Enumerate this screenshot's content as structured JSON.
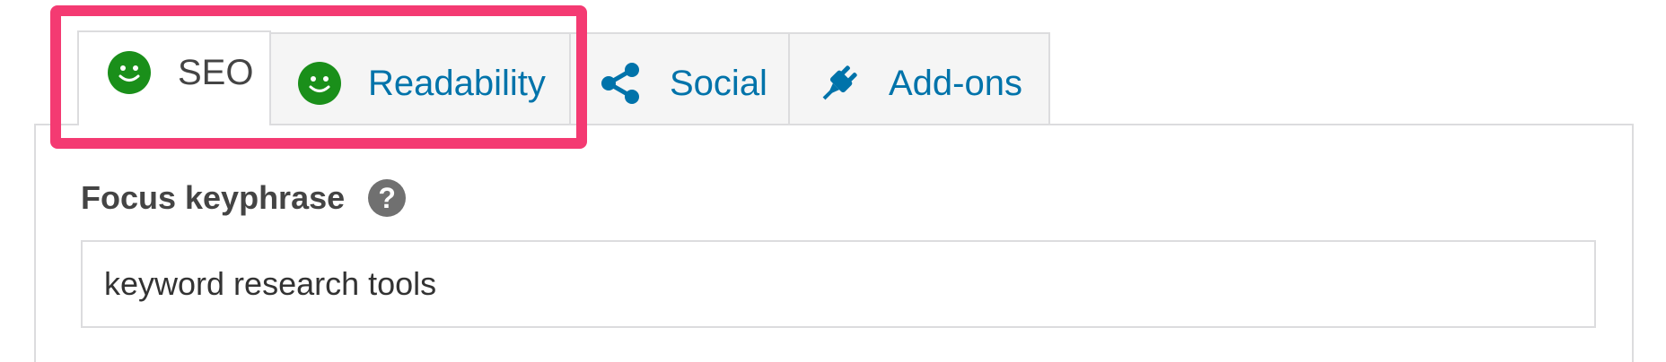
{
  "tabs": {
    "seo": {
      "label": "SEO",
      "icon": "smiley-face-icon",
      "status_color": "#1a8f1a"
    },
    "readability": {
      "label": "Readability",
      "icon": "smiley-face-icon",
      "status_color": "#1a8f1a"
    },
    "social": {
      "label": "Social",
      "icon": "share-icon"
    },
    "addons": {
      "label": "Add-ons",
      "icon": "plug-icon"
    },
    "active": "SEO"
  },
  "focus": {
    "label": "Focus keyphrase",
    "help_symbol": "?",
    "value": "keyword research tools"
  },
  "colors": {
    "link": "#0073aa",
    "highlight": "#f43a72",
    "good": "#1a8f1a"
  }
}
